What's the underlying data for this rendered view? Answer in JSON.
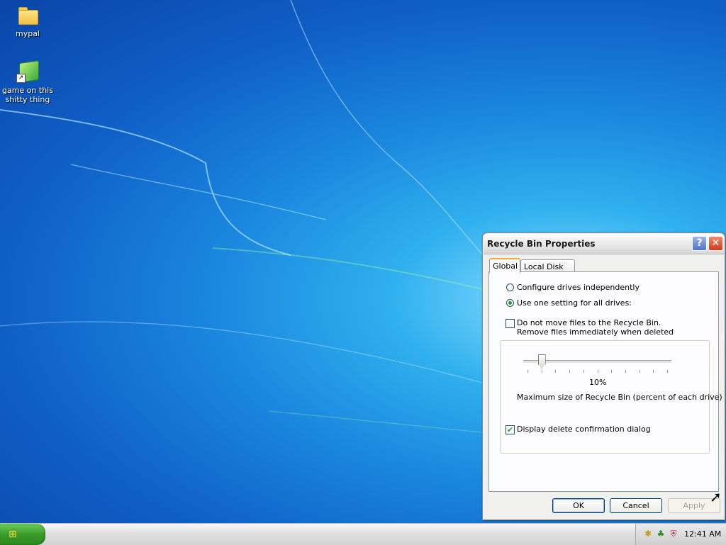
{
  "desktop": {
    "icons": [
      {
        "label_line1": "mypal",
        "label_line2": ""
      },
      {
        "label_line1": "game on this",
        "label_line2": "shitty thing"
      }
    ]
  },
  "dialog": {
    "title": "Recycle Bin Properties",
    "help_glyph": "?",
    "close_glyph": "✕",
    "tabs": [
      "Global",
      "Local Disk (C:)"
    ],
    "active_tab": "Global",
    "radio_independent": "Configure drives independently",
    "radio_one_setting": "Use one setting for all drives:",
    "selected_radio": "one_setting",
    "no_move_line1": "Do not move files to the Recycle Bin.",
    "no_move_line2": "Remove files immediately when deleted",
    "no_move_checked": false,
    "slider_value": "10%",
    "slider_percent": 10,
    "slider_caption": "Maximum size of Recycle Bin (percent of each drive)",
    "confirm_label": "Display delete confirmation dialog",
    "confirm_checked": true,
    "confirm_glyph": "✔",
    "buttons": {
      "ok": "OK",
      "cancel": "Cancel",
      "apply": "Apply"
    }
  },
  "taskbar": {
    "start_glyph": "⊞",
    "clock": "12:41 AM",
    "tray_icons": [
      "network-icon",
      "safely-remove-icon",
      "security-shield-icon"
    ]
  }
}
